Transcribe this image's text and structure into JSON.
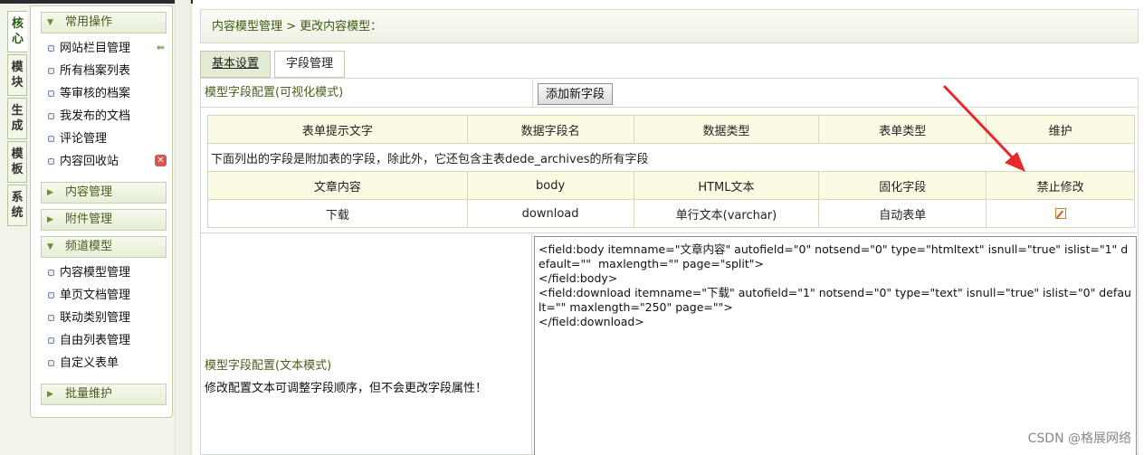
{
  "vertical_tabs": [
    "核心",
    "模块",
    "生成",
    "模板",
    "系统"
  ],
  "sidebar": {
    "sections": [
      {
        "title": "常用操作",
        "expanded": true,
        "items": [
          {
            "label": "网站栏目管理",
            "icon": "add-icon"
          },
          {
            "label": "所有档案列表"
          },
          {
            "label": "等审核的档案"
          },
          {
            "label": "我发布的文档"
          },
          {
            "label": "评论管理"
          },
          {
            "label": "内容回收站",
            "icon": "delete-icon"
          }
        ]
      },
      {
        "title": "内容管理",
        "expanded": false,
        "items": []
      },
      {
        "title": "附件管理",
        "expanded": false,
        "items": []
      },
      {
        "title": "频道模型",
        "expanded": true,
        "items": [
          {
            "label": "内容模型管理"
          },
          {
            "label": "单页文档管理"
          },
          {
            "label": "联动类别管理"
          },
          {
            "label": "自由列表管理"
          },
          {
            "label": "自定义表单"
          }
        ]
      },
      {
        "title": "批量维护",
        "expanded": false,
        "items": []
      }
    ]
  },
  "breadcrumb": "内容模型管理 > 更改内容模型：",
  "tabs": [
    {
      "label": "基本设置",
      "active": true
    },
    {
      "label": "字段管理",
      "active": false
    }
  ],
  "visual_config": {
    "label": "模型字段配置(可视化模式)",
    "add_button": "添加新字段"
  },
  "field_table": {
    "headers": [
      "表单提示文字",
      "数据字段名",
      "数据类型",
      "表单类型",
      "维护"
    ],
    "note": "下面列出的字段是附加表的字段，除此外，它还包含主表dede_archives的所有字段",
    "rows": [
      {
        "cells": [
          "文章内容",
          "body",
          "HTML文本",
          "固化字段",
          "禁止修改"
        ],
        "fixed": true
      },
      {
        "cells": [
          "下载",
          "download",
          "单行文本(varchar)",
          "自动表单",
          ""
        ],
        "fixed": false,
        "edit_icon": "edit-icon"
      }
    ]
  },
  "text_config": {
    "label": "模型字段配置(文本模式)",
    "note": "修改配置文本可调整字段顺序，但不会更改字段属性！",
    "lines": [
      "<field:body itemname=\"文章内容\" autofield=\"0\" notsend=\"0\" type=\"htmltext\" isnull=\"true\" islist=\"1\" default=\"\"  maxlength=\"\" page=\"split\">",
      "</field:body>",
      "<field:download itemname=\"下载\" autofield=\"1\" notsend=\"0\" type=\"text\" isnull=\"true\" islist=\"0\" default=\"\" maxlength=\"250\" page=\"\">",
      "</field:download>"
    ]
  },
  "watermark": "CSDN @格展网络",
  "colors": {
    "accent_green": "#4b5f1c",
    "annotation_red": "#e8282b"
  }
}
